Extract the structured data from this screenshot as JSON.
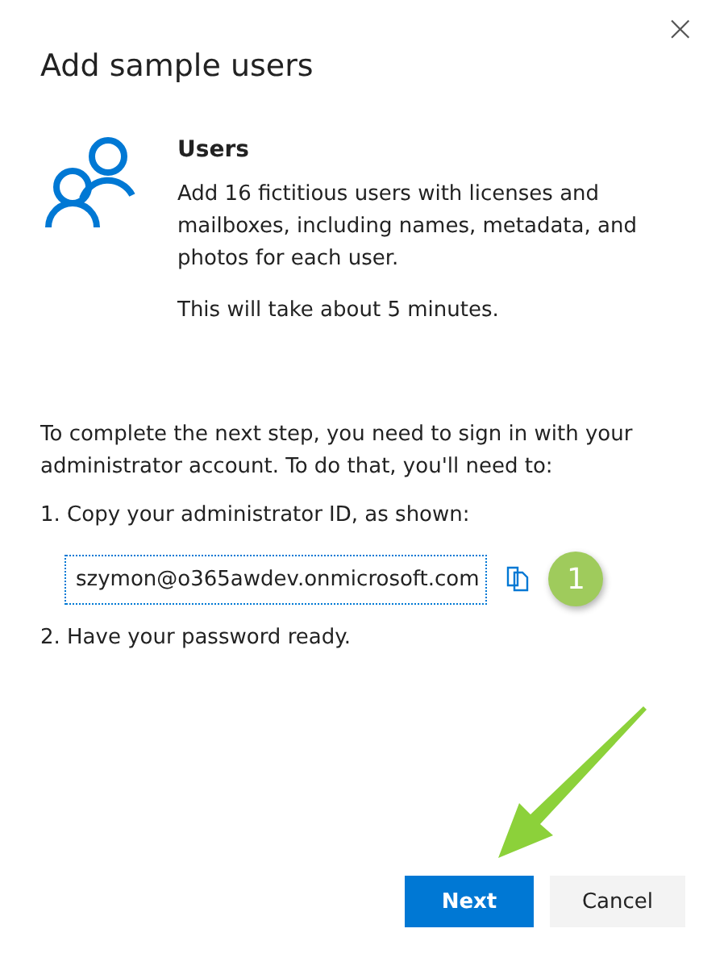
{
  "dialog": {
    "title": "Add sample users",
    "close": "×"
  },
  "section": {
    "heading": "Users",
    "description": "Add 16 fictitious users with licenses and mailboxes, including names, metadata, and photos for each user.",
    "duration": "This will take about 5 minutes."
  },
  "instructions": "To complete the next step, you need to sign in with your administrator account. To do that, you'll need to:",
  "steps": [
    {
      "text": "1. Copy your administrator ID, as shown:",
      "kind": "copy",
      "value": "szymon@o365awdev.onmicrosoft.com",
      "badge": "1"
    },
    {
      "text": "2. Have your password ready.",
      "kind": "plain"
    }
  ],
  "buttons": [
    {
      "label": "Next",
      "kind": "primary"
    },
    {
      "label": "Cancel",
      "kind": "secondary"
    }
  ]
}
